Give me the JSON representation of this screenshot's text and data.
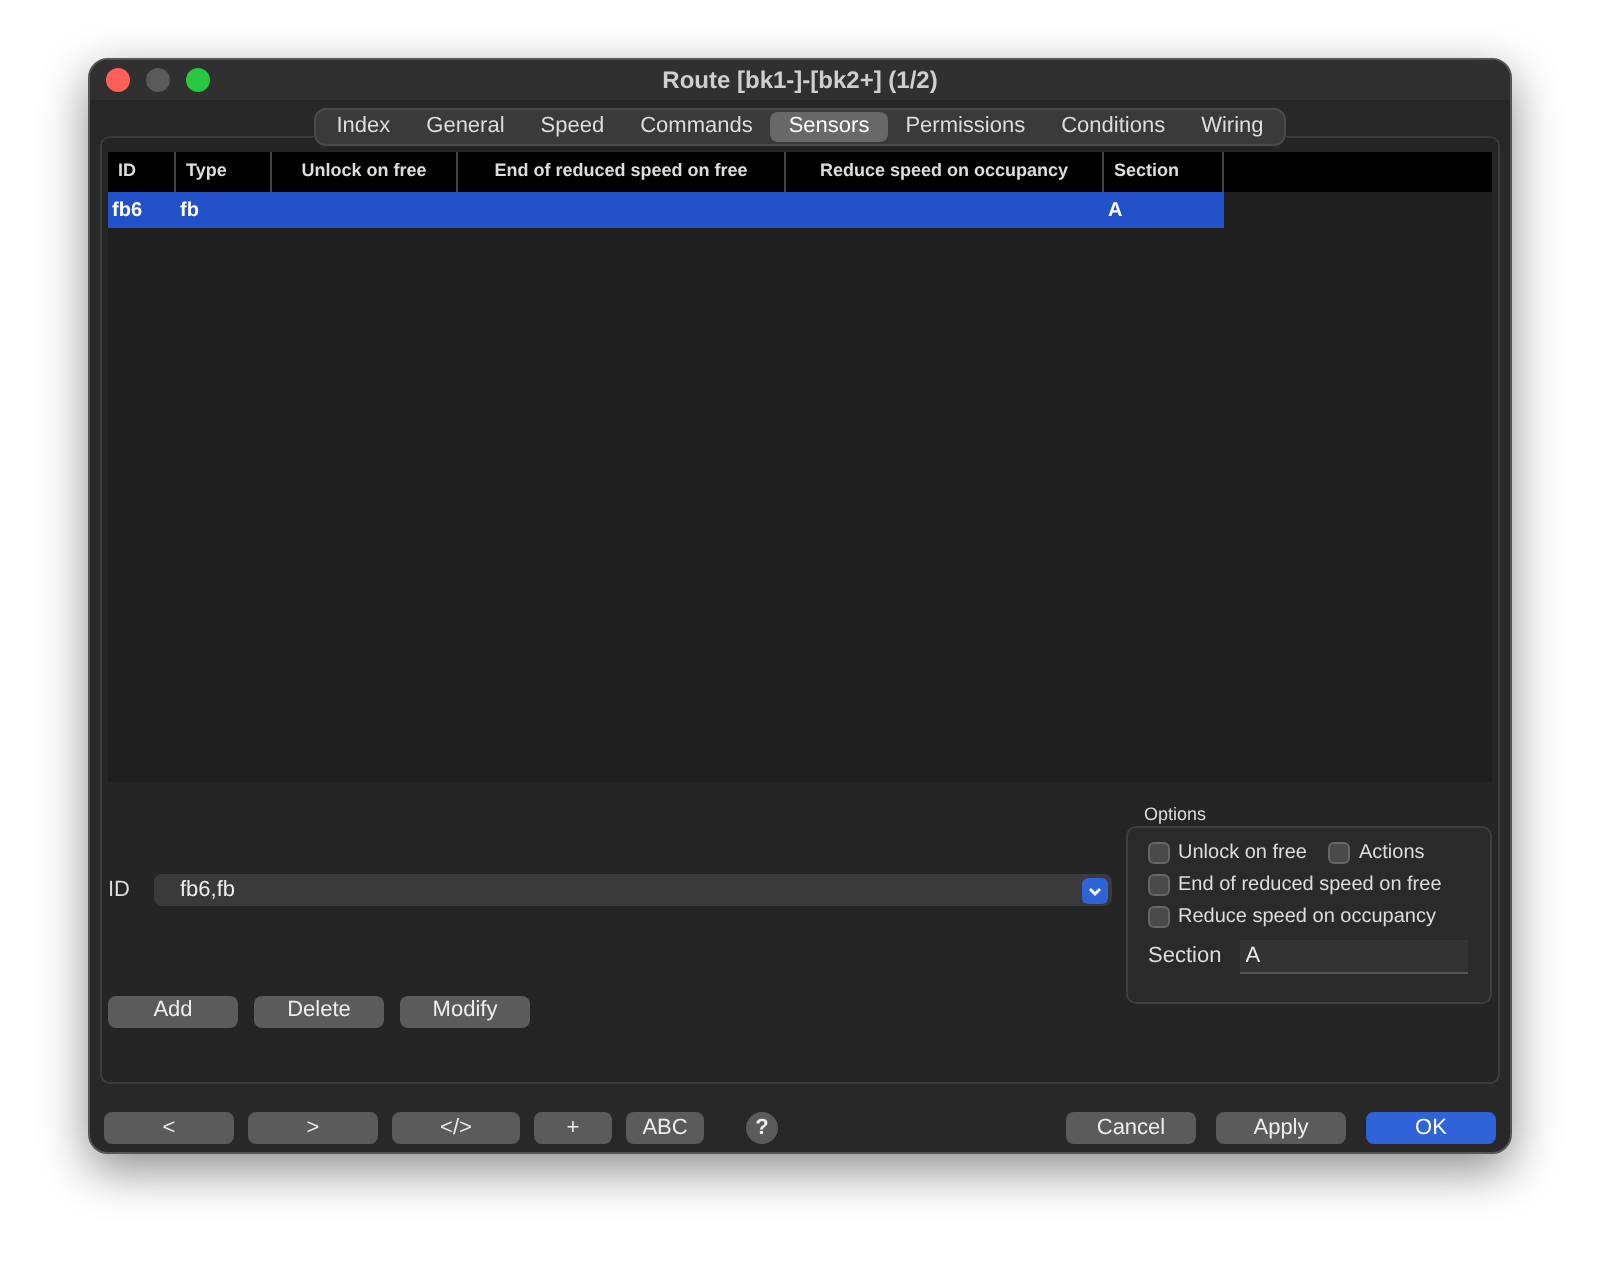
{
  "window": {
    "title": "Route [bk1-]-[bk2+] (1/2)"
  },
  "tabs": [
    {
      "label": "Index",
      "selected": false
    },
    {
      "label": "General",
      "selected": false
    },
    {
      "label": "Speed",
      "selected": false
    },
    {
      "label": "Commands",
      "selected": false
    },
    {
      "label": "Sensors",
      "selected": true
    },
    {
      "label": "Permissions",
      "selected": false
    },
    {
      "label": "Conditions",
      "selected": false
    },
    {
      "label": "Wiring",
      "selected": false
    }
  ],
  "table": {
    "columns": [
      "ID",
      "Type",
      "Unlock on free",
      "End of reduced speed on free",
      "Reduce speed on occupancy",
      "Section"
    ],
    "rows": [
      {
        "cells": [
          "fb6",
          "fb",
          "",
          "",
          "",
          "A"
        ],
        "selected": true
      }
    ]
  },
  "id_field": {
    "label": "ID",
    "value": "fb6,fb"
  },
  "options": {
    "title": "Options",
    "checkboxes": [
      {
        "label": "Unlock on free",
        "checked": false
      },
      {
        "label": "Actions",
        "checked": false
      },
      {
        "label": "End of reduced speed on free",
        "checked": false
      },
      {
        "label": "Reduce speed on occupancy",
        "checked": false
      }
    ],
    "section": {
      "label": "Section",
      "value": "A"
    }
  },
  "row_buttons": [
    "Add",
    "Delete",
    "Modify"
  ],
  "tool_buttons": [
    {
      "kind": "text",
      "label": "<"
    },
    {
      "kind": "text",
      "label": ">"
    },
    {
      "kind": "text",
      "label": "</>"
    },
    {
      "kind": "text",
      "label": "+"
    },
    {
      "kind": "text",
      "label": "ABC"
    },
    {
      "kind": "help",
      "label": "?"
    }
  ],
  "dialog_buttons": [
    {
      "label": "Cancel",
      "default": false
    },
    {
      "label": "Apply",
      "default": false
    },
    {
      "label": "OK",
      "default": true
    }
  ]
}
